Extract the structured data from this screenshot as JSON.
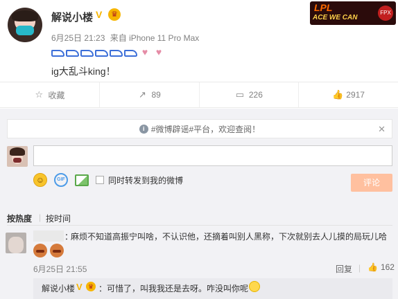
{
  "post": {
    "username": "解说小楼",
    "date": "6月25日 21:23",
    "source": "来自 iPhone 11 Pro Max",
    "text": "ig大乱斗king！",
    "brand_line1": "LPL",
    "brand_line2": "ACE WE CAN",
    "brand_badge": "FPX"
  },
  "actions": {
    "favorite_label": "收藏",
    "repost_count": "89",
    "comment_count": "226",
    "like_count": "2917"
  },
  "comment_box": {
    "notice": "#微博辟谣#平台，欢迎查阅！",
    "input_value": "",
    "gif_label": "GIF",
    "forward_label": "同时转发到我的微博",
    "submit_label": "评论"
  },
  "sort": {
    "hot_label": "按热度",
    "separator": "|",
    "time_label": "按时间"
  },
  "comment": {
    "colon": "：",
    "text": "麻烦不知道高振宁叫啥，不认识他，还摘着叫别人黑称，下次就别去人儿摸的局玩儿哈",
    "time": "6月25日 21:55",
    "reply_label": "回复",
    "separator": "|",
    "like_count": "162"
  },
  "reply": {
    "name": "解说小楼",
    "text": "：可惜了，叫我我还是去呀。咋没叫你呢"
  },
  "colors": {
    "accent": "#f7b500",
    "submit_bg": "#ffc09f",
    "comment_area_bg": "#f2f2f5"
  }
}
